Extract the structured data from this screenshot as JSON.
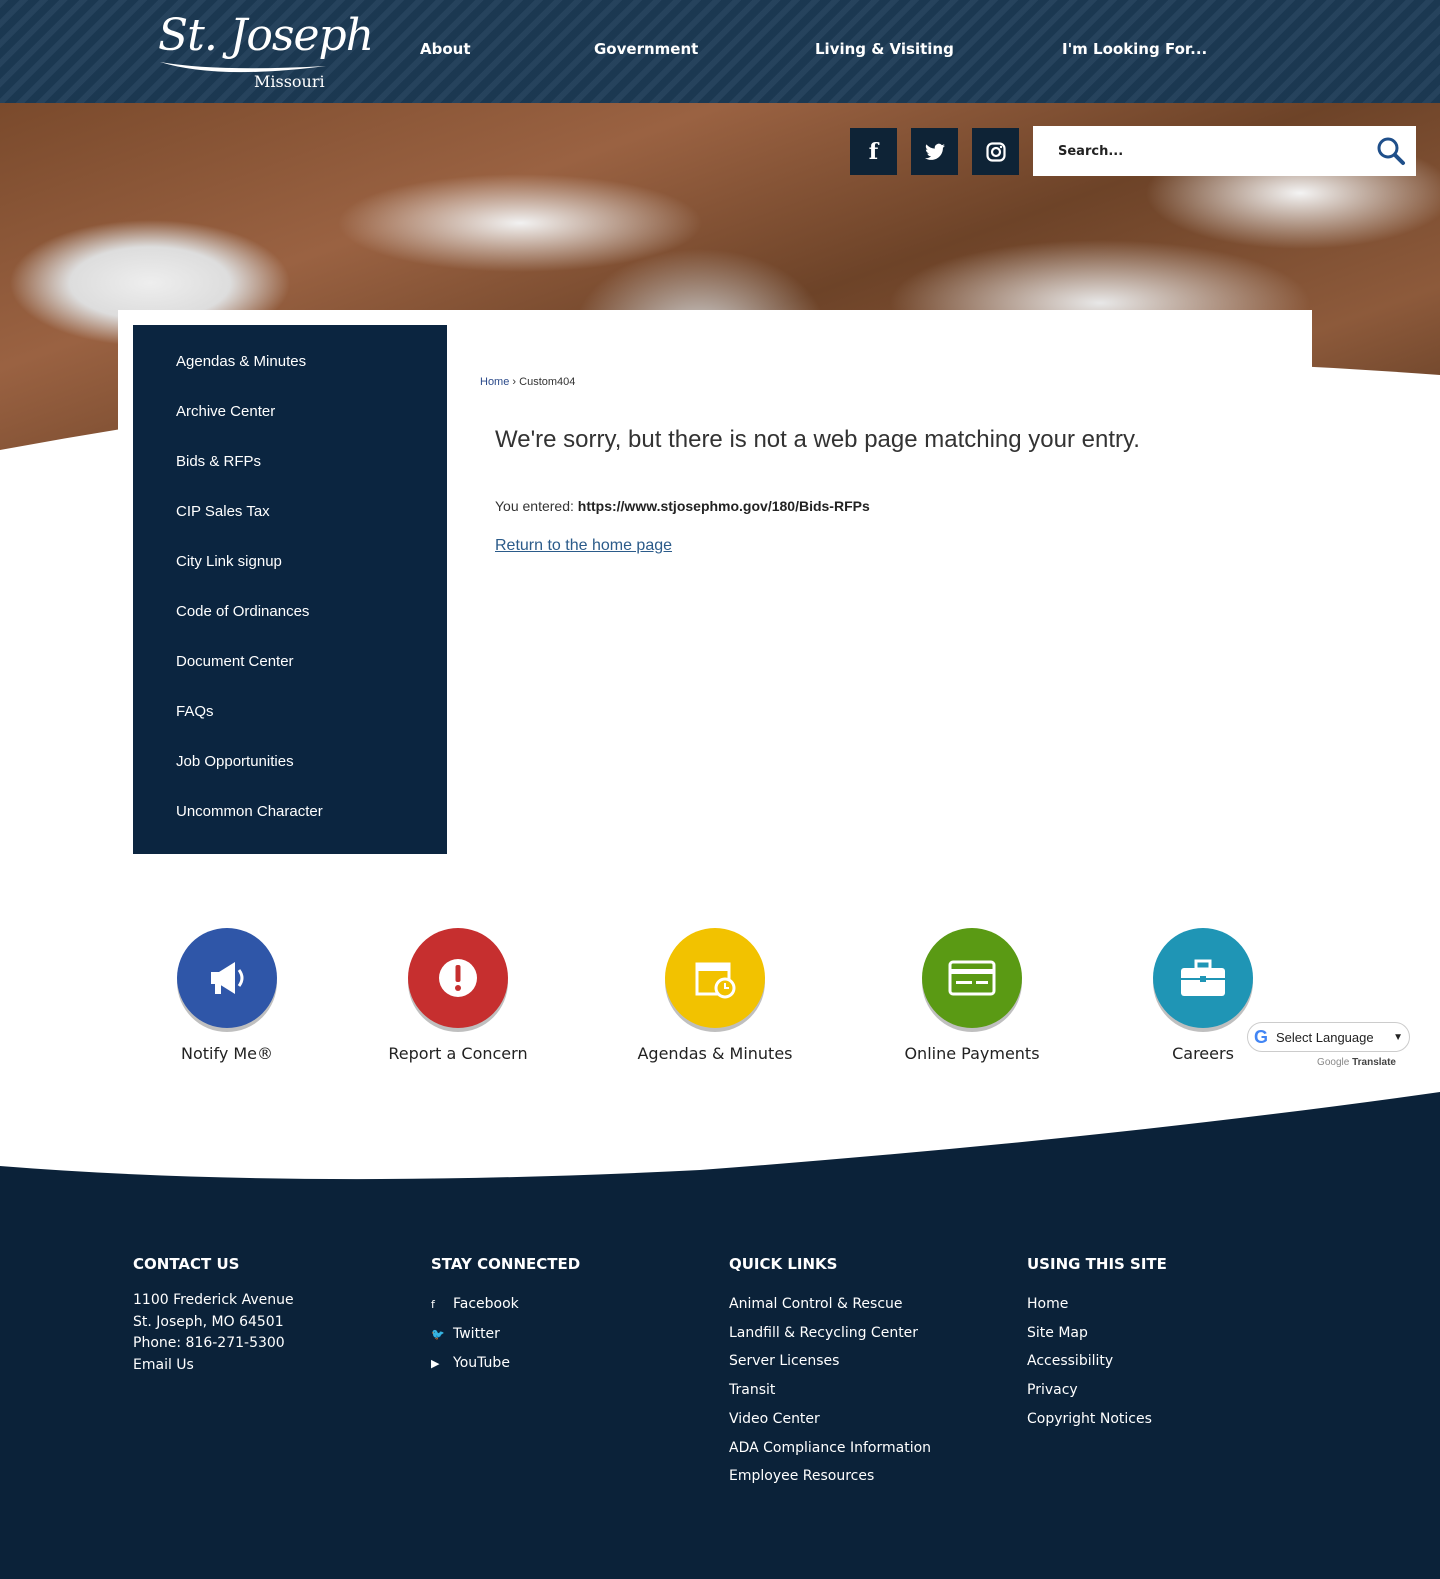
{
  "header": {
    "logo_main": "St. Joseph",
    "logo_sub": "Missouri",
    "nav": [
      "About",
      "Government",
      "Living & Visiting",
      "I'm Looking For..."
    ]
  },
  "social": [
    {
      "icon": "facebook-icon",
      "glyph": "f"
    },
    {
      "icon": "twitter-icon",
      "glyph": "🐦"
    },
    {
      "icon": "instagram-icon",
      "glyph": "◎"
    }
  ],
  "search": {
    "placeholder": "Search..."
  },
  "sidebar": {
    "items": [
      "Agendas & Minutes",
      "Archive Center",
      "Bids & RFPs",
      "CIP Sales Tax",
      "City Link signup",
      "Code of Ordinances",
      "Document Center",
      "FAQs",
      "Job Opportunities",
      "Uncommon Character"
    ]
  },
  "breadcrumb": {
    "home": "Home",
    "sep": "›",
    "current": "Custom404"
  },
  "main": {
    "heading": "We're sorry, but there is not a web page matching your entry.",
    "entered_label": "You entered:",
    "entered_url": "https://www.stjosephmo.gov/180/Bids-RFPs",
    "return_link": "Return to the home page"
  },
  "quick_links": [
    {
      "label": "Notify Me®",
      "color": "#2f56a8"
    },
    {
      "label": "Report a Concern",
      "color": "#c62f2f"
    },
    {
      "label": "Agendas & Minutes",
      "color": "#f2c200"
    },
    {
      "label": "Online Payments",
      "color": "#5a9a14"
    },
    {
      "label": "Careers",
      "color": "#1f95b5"
    }
  ],
  "translate": {
    "select": "Select Language",
    "by_google": "Google",
    "by_translate": "Translate"
  },
  "footer": {
    "contact": {
      "title": "CONTACT US",
      "lines": [
        "1100 Frederick Avenue",
        "St. Joseph, MO 64501",
        "Phone: 816-271-5300",
        "Email Us"
      ]
    },
    "stay": {
      "title": "STAY CONNECTED",
      "links": [
        "Facebook",
        "Twitter",
        "YouTube"
      ]
    },
    "quick": {
      "title": "QUICK LINKS",
      "links": [
        "Animal Control & Rescue",
        "Landfill & Recycling Center",
        "Server Licenses",
        "Transit",
        "Video Center",
        "ADA Compliance Information",
        "Employee Resources"
      ]
    },
    "using": {
      "title": "USING THIS SITE",
      "links": [
        "Home",
        "Site Map",
        "Accessibility",
        "Privacy",
        "Copyright Notices"
      ]
    }
  }
}
